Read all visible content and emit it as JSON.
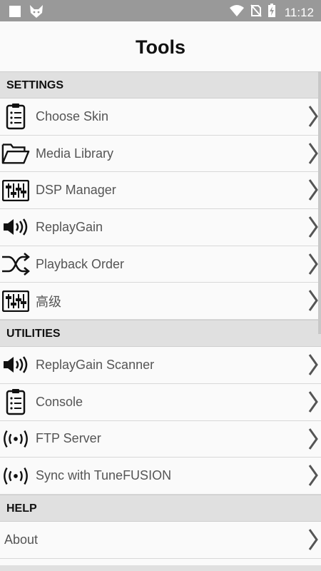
{
  "status": {
    "time": "11:12"
  },
  "header": {
    "title": "Tools"
  },
  "sections": {
    "settings": {
      "title": "SETTINGS",
      "items": [
        "Choose Skin",
        "Media Library",
        "DSP Manager",
        "ReplayGain",
        "Playback Order",
        "高级"
      ]
    },
    "utilities": {
      "title": "UTILITIES",
      "items": [
        "ReplayGain Scanner",
        "Console",
        "FTP Server",
        "Sync with TuneFUSION"
      ]
    },
    "help": {
      "title": "HELP",
      "items": [
        "About"
      ]
    }
  },
  "icons": {
    "status": [
      "square-icon",
      "fox-icon",
      "wifi-icon",
      "no-sim-icon",
      "battery-charging-icon"
    ],
    "rows": [
      "clipboard-list-icon",
      "folder-open-icon",
      "equalizer-icon",
      "speaker-icon",
      "shuffle-icon",
      "equalizer-icon",
      "speaker-icon",
      "clipboard-list-icon",
      "broadcast-icon",
      "broadcast-icon"
    ],
    "chevron": "chevron-right-icon"
  },
  "colors": {
    "statusbar": "#999999",
    "section": "#e0e0e0",
    "text": "#555555"
  }
}
